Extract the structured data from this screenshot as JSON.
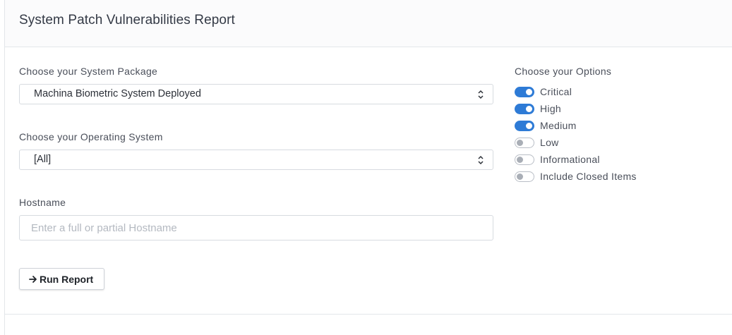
{
  "report": {
    "title": "System Patch Vulnerabilities Report"
  },
  "form": {
    "package": {
      "label": "Choose your System Package",
      "selected": "Machina Biometric System Deployed"
    },
    "os": {
      "label": "Choose your Operating System",
      "selected": "[All]"
    },
    "hostname": {
      "label": "Hostname",
      "value": "",
      "placeholder": "Enter a full or partial Hostname"
    },
    "run_button": {
      "label": "Run Report",
      "icon": "arrow-right-icon"
    }
  },
  "options": {
    "title": "Choose your Options",
    "items": [
      {
        "label": "Critical",
        "on": true
      },
      {
        "label": "High",
        "on": true
      },
      {
        "label": "Medium",
        "on": true
      },
      {
        "label": "Low",
        "on": false
      },
      {
        "label": "Informational",
        "on": false
      },
      {
        "label": "Include Closed Items",
        "on": false
      }
    ]
  },
  "colors": {
    "accent": "#2e7bd6",
    "toggle_off_knob": "#a9aeb6",
    "border": "#d7dbe0"
  }
}
